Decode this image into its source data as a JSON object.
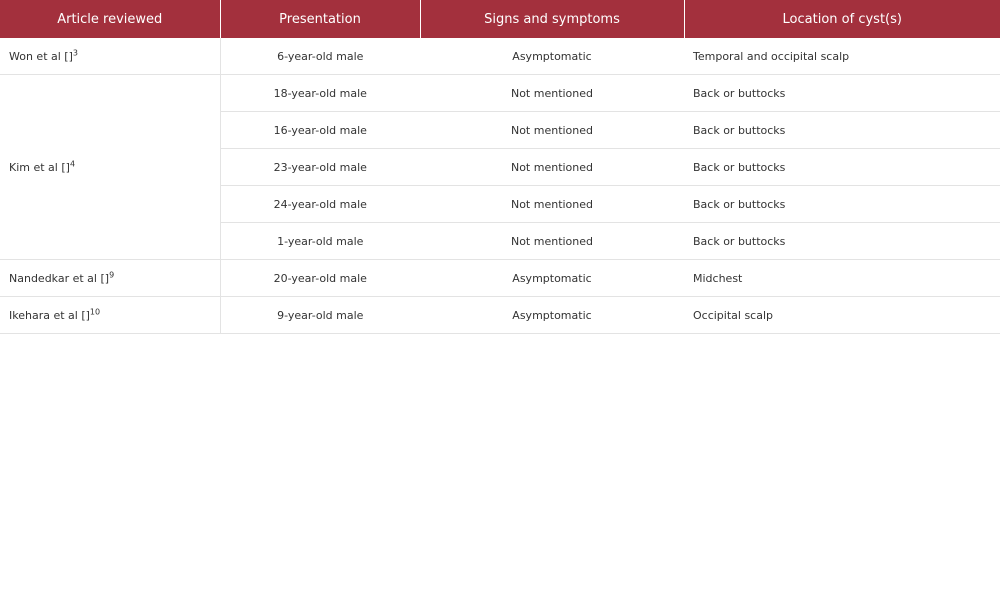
{
  "table": {
    "headers": [
      "Article reviewed",
      "Presentation",
      "Signs and symptoms",
      "Location of cyst(s)"
    ],
    "groups": [
      {
        "article": "Won et al []",
        "ref": "3",
        "rows": [
          {
            "presentation": "6-year-old male",
            "signs": "Asymptomatic",
            "location": "Temporal and occipital scalp"
          }
        ]
      },
      {
        "article": "Kim et al []",
        "ref": "4",
        "rows": [
          {
            "presentation": "18-year-old male",
            "signs": "Not mentioned",
            "location": "Back or buttocks"
          },
          {
            "presentation": "16-year-old male",
            "signs": "Not mentioned",
            "location": "Back or buttocks"
          },
          {
            "presentation": "23-year-old male",
            "signs": "Not mentioned",
            "location": "Back or buttocks"
          },
          {
            "presentation": "24-year-old male",
            "signs": "Not mentioned",
            "location": "Back or buttocks"
          },
          {
            "presentation": "1-year-old male",
            "signs": "Not mentioned",
            "location": "Back or buttocks"
          }
        ]
      },
      {
        "article": "Nandedkar et al []",
        "ref": "9",
        "rows": [
          {
            "presentation": "20-year-old male",
            "signs": "Asymptomatic",
            "location": "Midchest"
          }
        ]
      },
      {
        "article": "Ikehara et al []",
        "ref": "10",
        "rows": [
          {
            "presentation": "9-year-old male",
            "signs": "Asymptomatic",
            "location": "Occipital scalp"
          }
        ]
      }
    ]
  }
}
